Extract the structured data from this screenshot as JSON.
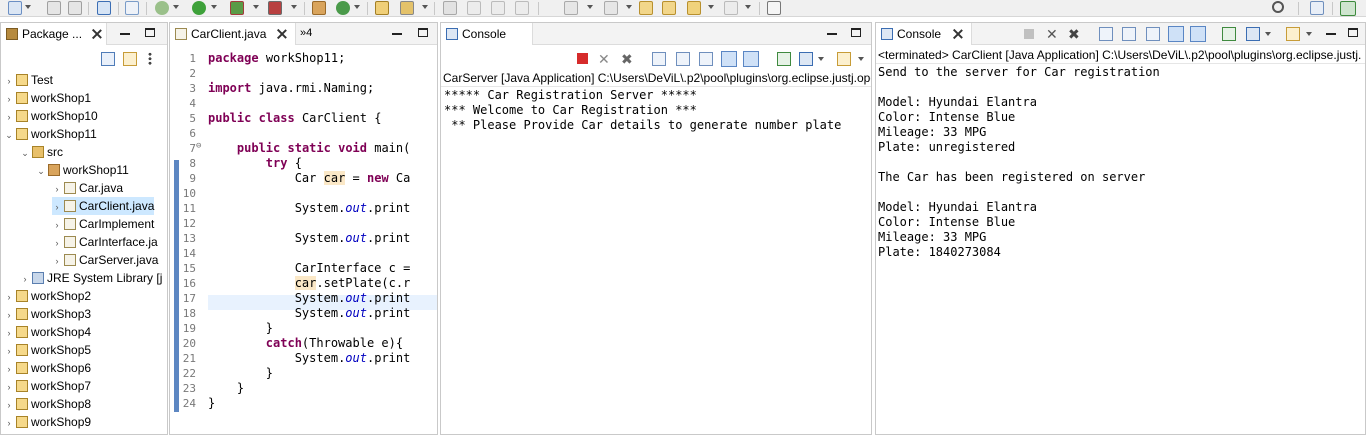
{
  "package_explorer": {
    "tab_label": "Package ...",
    "tree": [
      {
        "label": "Test",
        "expander": "›",
        "kind": "project"
      },
      {
        "label": "workShop1",
        "expander": "›",
        "kind": "project"
      },
      {
        "label": "workShop10",
        "expander": "›",
        "kind": "project"
      },
      {
        "label": "workShop11",
        "expander": "⌄",
        "kind": "project"
      },
      {
        "label": "src",
        "expander": "⌄",
        "kind": "folder"
      },
      {
        "label": "workShop11",
        "expander": "⌄",
        "kind": "package"
      },
      {
        "label": "Car.java",
        "expander": "›",
        "kind": "java"
      },
      {
        "label": "CarClient.java",
        "expander": "›",
        "kind": "java",
        "selected": true
      },
      {
        "label": "CarImplement",
        "expander": "›",
        "kind": "java"
      },
      {
        "label": "CarInterface.ja",
        "expander": "›",
        "kind": "java"
      },
      {
        "label": "CarServer.java",
        "expander": "›",
        "kind": "java"
      },
      {
        "label": "JRE System Library [j",
        "expander": "›",
        "kind": "library"
      },
      {
        "label": "workShop2",
        "expander": "›",
        "kind": "project"
      },
      {
        "label": "workShop3",
        "expander": "›",
        "kind": "project"
      },
      {
        "label": "workShop4",
        "expander": "›",
        "kind": "project"
      },
      {
        "label": "workShop5",
        "expander": "›",
        "kind": "project"
      },
      {
        "label": "workShop6",
        "expander": "›",
        "kind": "project"
      },
      {
        "label": "workShop7",
        "expander": "›",
        "kind": "project"
      },
      {
        "label": "workShop8",
        "expander": "›",
        "kind": "project"
      },
      {
        "label": "workShop9",
        "expander": "›",
        "kind": "project"
      }
    ]
  },
  "editor": {
    "tab_label": "CarClient.java",
    "overflow_label": "»4",
    "lines": [
      {
        "n": "1",
        "code": "package workShop11;"
      },
      {
        "n": "2",
        "code": ""
      },
      {
        "n": "3",
        "code": "import java.rmi.Naming;"
      },
      {
        "n": "4",
        "code": ""
      },
      {
        "n": "5",
        "code": "public class CarClient {"
      },
      {
        "n": "6",
        "code": ""
      },
      {
        "n": "7",
        "code": "    public static void main("
      },
      {
        "n": "8",
        "code": "        try {"
      },
      {
        "n": "9",
        "code": "            Car car = new Ca"
      },
      {
        "n": "10",
        "code": ""
      },
      {
        "n": "11",
        "code": "            System.out.print"
      },
      {
        "n": "12",
        "code": ""
      },
      {
        "n": "13",
        "code": "            System.out.print"
      },
      {
        "n": "14",
        "code": ""
      },
      {
        "n": "15",
        "code": "            CarInterface c ="
      },
      {
        "n": "16",
        "code": "            car.setPlate(c.r"
      },
      {
        "n": "17",
        "code": "            System.out.print"
      },
      {
        "n": "18",
        "code": "            System.out.print"
      },
      {
        "n": "19",
        "code": "        }"
      },
      {
        "n": "20",
        "code": "        catch(Throwable e){"
      },
      {
        "n": "21",
        "code": "            System.out.print"
      },
      {
        "n": "22",
        "code": "        }"
      },
      {
        "n": "23",
        "code": "    }"
      },
      {
        "n": "24",
        "code": "}"
      }
    ]
  },
  "console_server": {
    "tab_label": "Console",
    "description": "CarServer [Java Application] C:\\Users\\DeViL\\.p2\\pool\\plugins\\org.eclipse.justj.ope",
    "output": [
      "***** Car Registration Server *****",
      "*** Welcome to Car Registration ***",
      " ** Please Provide Car details to generate number plate"
    ]
  },
  "console_client": {
    "tab_label": "Console",
    "description": "<terminated> CarClient [Java Application] C:\\Users\\DeViL\\.p2\\pool\\plugins\\org.eclipse.justj.",
    "output": [
      "Send to the server for Car registration",
      "",
      "Model: Hyundai Elantra",
      "Color: Intense Blue",
      "Mileage: 33 MPG",
      "Plate: unregistered",
      "",
      "The Car has been registered on server",
      "",
      "Model: Hyundai Elantra",
      "Color: Intense Blue",
      "Mileage: 33 MPG",
      "Plate: 1840273084"
    ]
  },
  "colors": {
    "keyword": "#7f0055",
    "field": "#0000c0",
    "selection": "#cde8ff",
    "current_line": "#e8f2fe",
    "changed_ruler": "#5d87c2"
  }
}
